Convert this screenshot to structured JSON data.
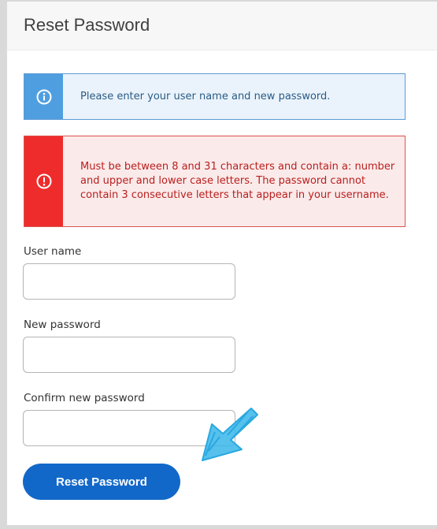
{
  "panel": {
    "title": "Reset Password"
  },
  "alerts": {
    "info": {
      "icon": "info-icon",
      "message": "Please enter your user name and new password."
    },
    "error": {
      "icon": "exclamation-icon",
      "message": "Must be between 8 and 31 characters and contain a: number and upper and lower case letters. The password cannot contain 3 consecutive letters that appear in your username."
    }
  },
  "form": {
    "username": {
      "label": "User name",
      "value": "",
      "placeholder": ""
    },
    "new_password": {
      "label": "New password",
      "value": "",
      "placeholder": ""
    },
    "confirm_password": {
      "label": "Confirm new password",
      "value": "",
      "placeholder": ""
    },
    "submit_label": "Reset Password"
  },
  "colors": {
    "info_accent": "#4f9fe0",
    "error_accent": "#ef2c2c",
    "button": "#1268c9",
    "annotation_arrow": "#29a8e0"
  }
}
